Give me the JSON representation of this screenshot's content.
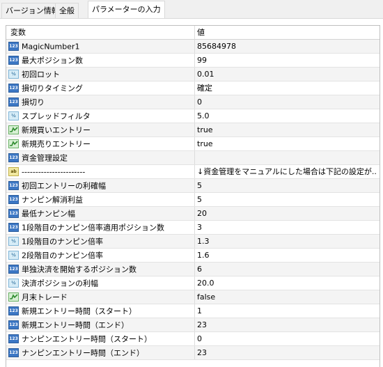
{
  "tabs": [
    {
      "label": "バージョン情報",
      "active": false
    },
    {
      "label": "全般",
      "active": false
    },
    {
      "label": "パラメーターの入力",
      "active": true
    }
  ],
  "table": {
    "headers": {
      "variable": "変数",
      "value": "値"
    },
    "rows": [
      {
        "icon": "int",
        "icon_text": "123",
        "name": "MagicNumber1",
        "value": "85684978"
      },
      {
        "icon": "int",
        "icon_text": "123",
        "name": "最大ポジション数",
        "value": "99"
      },
      {
        "icon": "dbl",
        "icon_text": "½",
        "name": "初回ロット",
        "value": "0.01"
      },
      {
        "icon": "int",
        "icon_text": "123",
        "name": "損切りタイミング",
        "value": "確定"
      },
      {
        "icon": "int",
        "icon_text": "123",
        "name": "損切り",
        "value": "0"
      },
      {
        "icon": "dbl",
        "icon_text": "½",
        "name": "スプレッドフィルタ",
        "value": "5.0"
      },
      {
        "icon": "bool",
        "icon_text": "",
        "name": "新規買いエントリー",
        "value": "true"
      },
      {
        "icon": "bool",
        "icon_text": "",
        "name": "新規売りエントリー",
        "value": "true"
      },
      {
        "icon": "int",
        "icon_text": "123",
        "name": "資金管理設定",
        "value": ""
      },
      {
        "icon": "str",
        "icon_text": "ab",
        "name": "-----------------------",
        "value": "↓資金管理をマニュアルにした場合は下記の設定が.."
      },
      {
        "icon": "int",
        "icon_text": "123",
        "name": "初回エントリーの利確幅",
        "value": "5"
      },
      {
        "icon": "int",
        "icon_text": "123",
        "name": "ナンピン解消利益",
        "value": "5"
      },
      {
        "icon": "int",
        "icon_text": "123",
        "name": "最低ナンピン幅",
        "value": "20"
      },
      {
        "icon": "int",
        "icon_text": "123",
        "name": "1段階目のナンピン倍率適用ポジション数",
        "value": "3"
      },
      {
        "icon": "dbl",
        "icon_text": "½",
        "name": "1段階目のナンピン倍率",
        "value": "1.3"
      },
      {
        "icon": "dbl",
        "icon_text": "½",
        "name": "2段階目のナンピン倍率",
        "value": "1.6"
      },
      {
        "icon": "int",
        "icon_text": "123",
        "name": "単独決済を開始するポジション数",
        "value": "6"
      },
      {
        "icon": "dbl",
        "icon_text": "½",
        "name": "決済ポジションの利幅",
        "value": "20.0"
      },
      {
        "icon": "bool",
        "icon_text": "",
        "name": "月末トレード",
        "value": "false"
      },
      {
        "icon": "int",
        "icon_text": "123",
        "name": "新規エントリー時間（スタート）",
        "value": "1"
      },
      {
        "icon": "int",
        "icon_text": "123",
        "name": "新規エントリー時間（エンド）",
        "value": "23"
      },
      {
        "icon": "int",
        "icon_text": "123",
        "name": "ナンピンエントリー時間（スタート）",
        "value": "0"
      },
      {
        "icon": "int",
        "icon_text": "123",
        "name": "ナンピンエントリー時間（エンド）",
        "value": "23"
      }
    ]
  }
}
